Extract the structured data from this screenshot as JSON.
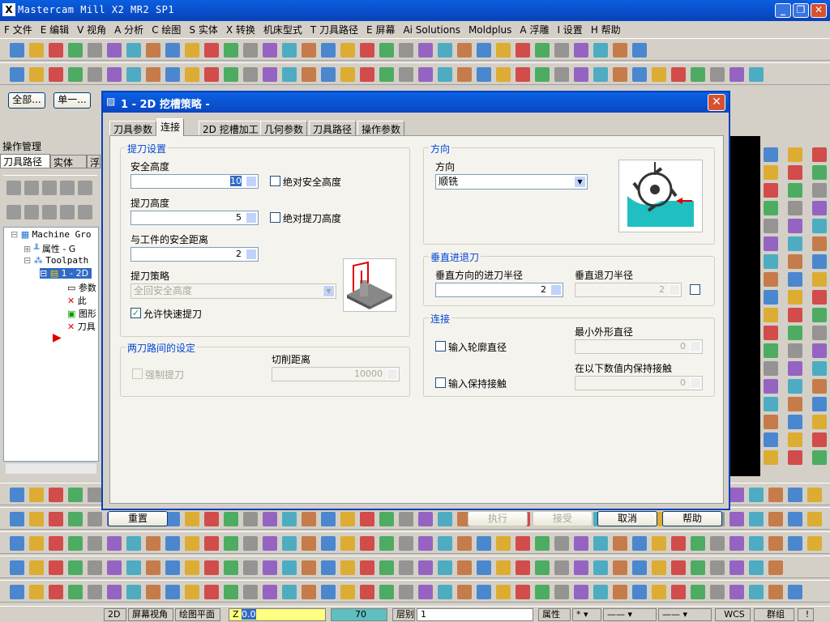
{
  "app": {
    "title": "Mastercam Mill  X2 MR2 SP1"
  },
  "menu": [
    "F 文件",
    "E 编辑",
    "V 视角",
    "A 分析",
    "C 绘图",
    "S 实体",
    "X 转换",
    "机床型式",
    "T 刀具路径",
    "E 屏幕",
    "Ai Solutions",
    "Moldplus",
    "A 浮雕",
    "I 设置",
    "H 帮助"
  ],
  "left_panel": {
    "all_button": "全部...",
    "single_button": "单一...",
    "title": "操作管理",
    "tabs": [
      "刀具路径",
      "实体",
      "浮"
    ],
    "tree": [
      "Machine Gro",
      "属性 - G",
      "Toolpath",
      "1 - 2D",
      "参数",
      "此",
      "图形",
      "刀具"
    ]
  },
  "dialog": {
    "title": "1 - 2D 挖槽策略 -",
    "tabs": [
      "刀具参数",
      "连接",
      "2D 挖槽加工",
      "几何参数",
      "刀具路径",
      "操作参数"
    ],
    "retract": {
      "group": "提刀设置",
      "safe_height_label": "安全高度",
      "safe_height_value": "10",
      "abs_safe_height": "绝对安全高度",
      "retract_height_label": "提刀高度",
      "retract_height_value": "5",
      "abs_retract_height": "绝对提刀高度",
      "stock_dist_label": "与工件的安全距离",
      "stock_dist_value": "2",
      "strategy_label": "提刀策略",
      "strategy_value": "全回安全高度",
      "allow_rapid": "允许快速提刀"
    },
    "between": {
      "group": "两刀路间的设定",
      "force_retract": "强制提刀",
      "cut_dist_label": "切削距离",
      "cut_dist_value": "10000"
    },
    "direction": {
      "group": "方向",
      "label": "方向",
      "value": "顺铣"
    },
    "vertical": {
      "group": "垂直进退刀",
      "entry_label": "垂直方向的进刀半径",
      "entry_value": "2",
      "exit_label": "垂直退刀半径",
      "exit_value": "2"
    },
    "link": {
      "group": "连接",
      "contour_dia": "输入轮廓直径",
      "min_dia_label": "最小外形直径",
      "min_dia_value": "0",
      "keep_contact": "输入保持接触",
      "keep_label": "在以下数值内保持接触",
      "keep_value": "0"
    },
    "buttons": {
      "reset": "重置",
      "run": "执行",
      "accept": "接受",
      "cancel": "取消",
      "help": "帮助"
    }
  },
  "status": {
    "view_2d": "2D",
    "screen_view": "屏幕视角",
    "plane": "绘图平面",
    "z_label": "Z",
    "z_value": "0.0",
    "color_value": "70",
    "level_label": "层别",
    "level_value": "1",
    "attr": "属性",
    "wcs": "WCS",
    "group": "群组"
  },
  "colors": {
    "title_blue": "#0a5fe0",
    "group_label": "#0046d5",
    "arrow_red": "#e00000",
    "cut_teal": "#20c0c0"
  }
}
